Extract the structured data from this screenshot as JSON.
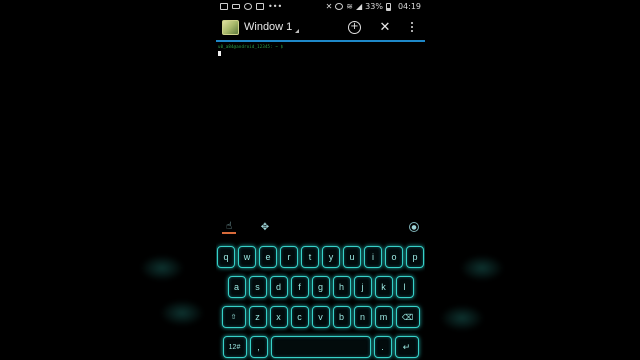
{
  "status_bar": {
    "battery_percent": "33%",
    "time": "04:19",
    "left_icons": [
      "app-notification-icon",
      "mail-icon",
      "do-not-disturb-icon",
      "screen-icon",
      "dots-icon"
    ],
    "right_icons": [
      "mute-icon",
      "alarm-icon",
      "wifi-icon",
      "signal-icon",
      "battery-icon"
    ]
  },
  "title_bar": {
    "window_title": "Window 1",
    "actions": {
      "new_window": "+",
      "close": "✕"
    }
  },
  "terminal": {
    "prompt_line": "u0_a84@android_12345: ~ $"
  },
  "keyboard": {
    "toolbar": {
      "icons": [
        "hand-icon",
        "move-icon",
        "settings-circle-icon"
      ]
    },
    "row1": [
      "q",
      "w",
      "e",
      "r",
      "t",
      "y",
      "u",
      "i",
      "o",
      "p"
    ],
    "row2": [
      "a",
      "s",
      "d",
      "f",
      "g",
      "h",
      "j",
      "k",
      "l"
    ],
    "row3": [
      "z",
      "x",
      "c",
      "v",
      "b",
      "n",
      "m"
    ],
    "row4": {
      "symbols": "12#",
      "comma": ",",
      "space": "",
      "period": ".",
      "enter": "↵"
    },
    "shift_label": "⇧",
    "backspace_label": "⌫"
  },
  "colors": {
    "accent_line": "#1e88c8",
    "key_glow": "#37d1c8",
    "prompt": "#2fa84a"
  }
}
